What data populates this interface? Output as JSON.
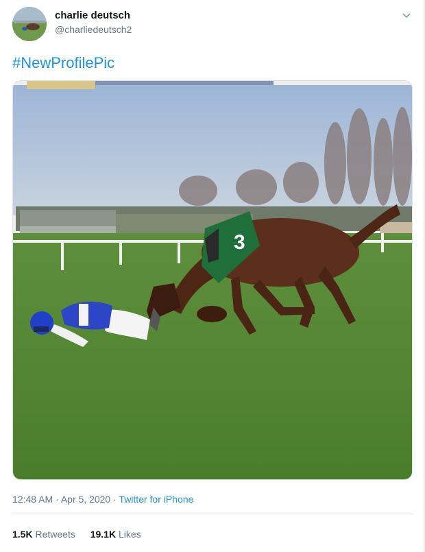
{
  "author": {
    "display_name": "charlie deutsch",
    "handle": "@charliedeutsch2"
  },
  "tweet": {
    "text": "#NewProfilePic"
  },
  "media": {
    "bib_number": "3"
  },
  "meta": {
    "time": "12:48 AM",
    "separator_1": " · ",
    "date": "Apr 5, 2020",
    "separator_2": " · ",
    "source": "Twitter for iPhone"
  },
  "stats": {
    "retweets_count": "1.5K",
    "retweets_label": "Retweets",
    "likes_count": "19.1K",
    "likes_label": "Likes"
  },
  "icons": {
    "caret": "chevron-down-icon"
  },
  "colors": {
    "link": "#1b95e0",
    "secondary_text": "#657786",
    "primary_text": "#14171a"
  }
}
